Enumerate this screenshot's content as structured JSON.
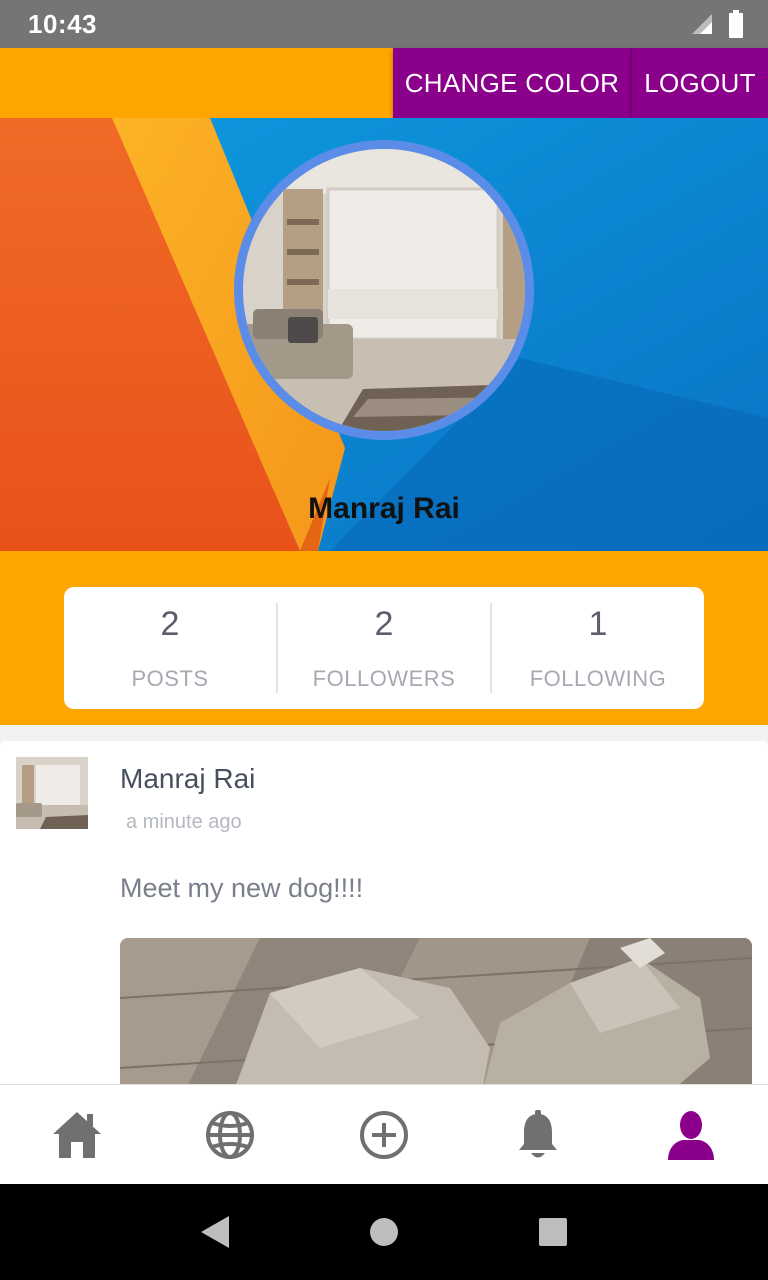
{
  "status_bar": {
    "time": "10:43"
  },
  "top_bar": {
    "change_color_label": "CHANGE COLOR",
    "logout_label": "LOGOUT"
  },
  "profile": {
    "name": "Manraj Rai"
  },
  "stats": [
    {
      "value": "2",
      "label": "POSTS"
    },
    {
      "value": "2",
      "label": "FOLLOWERS"
    },
    {
      "value": "1",
      "label": "FOLLOWING"
    }
  ],
  "post": {
    "author": "Manraj Rai",
    "time": "a minute ago",
    "text": "Meet my new dog!!!!"
  },
  "bottom_nav": {
    "items": [
      "home-icon",
      "globe-icon",
      "add-circle-icon",
      "bell-icon",
      "profile-icon"
    ],
    "active": "profile-icon"
  },
  "colors": {
    "accent_orange": "#FFA500",
    "button_purple": "#8B008B",
    "avatar_ring": "#5b8de8"
  }
}
